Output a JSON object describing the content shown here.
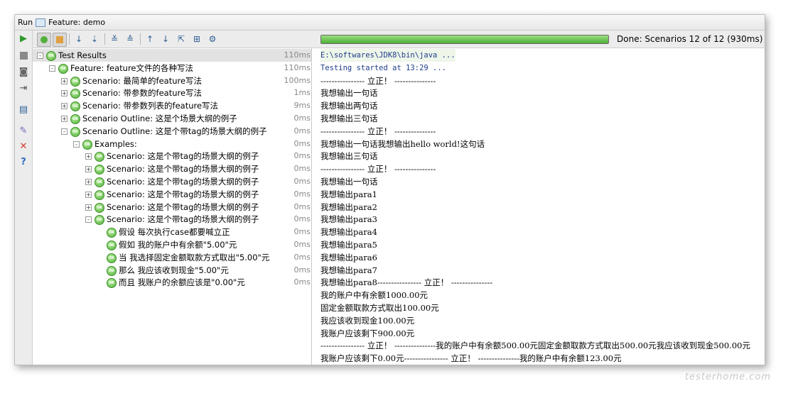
{
  "window": {
    "title_prefix": "Run",
    "tab_label": "Feature: demo"
  },
  "status": {
    "text": "Done: Scenarios 12 of 12  (930ms)",
    "progress_fraction": 1.0
  },
  "tree": {
    "rows": [
      {
        "label": "Test Results",
        "time": "110ms"
      },
      {
        "label": "Feature: feature文件的各种写法",
        "time": "110ms"
      },
      {
        "label": "Scenario: 最简单的feature写法",
        "time": "100ms"
      },
      {
        "label": "Scenario: 带参数的feature写法",
        "time": "1ms"
      },
      {
        "label": "Scenario: 带参数列表的feature写法",
        "time": "9ms"
      },
      {
        "label": "Scenario Outline: 这是个场景大纲的例子",
        "time": "0ms"
      },
      {
        "label": "Scenario Outline: 这是个带tag的场景大纲的例子",
        "time": "0ms"
      },
      {
        "label": "Examples:",
        "time": "0ms"
      },
      {
        "label": "Scenario: 这是个带tag的场景大纲的例子",
        "time": "0ms"
      },
      {
        "label": "Scenario: 这是个带tag的场景大纲的例子",
        "time": "0ms"
      },
      {
        "label": "Scenario: 这是个带tag的场景大纲的例子",
        "time": "0ms"
      },
      {
        "label": "Scenario: 这是个带tag的场景大纲的例子",
        "time": "0ms"
      },
      {
        "label": "Scenario: 这是个带tag的场景大纲的例子",
        "time": "0ms"
      },
      {
        "label": "Scenario: 这是个带tag的场景大纲的例子",
        "time": "0ms"
      },
      {
        "label": "假设 每次执行case都要喊立正",
        "time": "0ms"
      },
      {
        "label": "假如 我的账户中有余额\"5.00\"元",
        "time": "0ms"
      },
      {
        "label": "当 我选择固定金额取款方式取出\"5.00\"元",
        "time": "0ms"
      },
      {
        "label": "那么 我应该收到现金\"5.00\"元",
        "time": "0ms"
      },
      {
        "label": "而且 我账户的余额应该是\"0.00\"元",
        "time": "0ms"
      }
    ]
  },
  "console": {
    "lines": [
      "E:\\softwares\\JDK8\\bin\\java ...",
      "Testing started at 13:29 ...",
      "----------------  立正！  ---------------",
      "我想输出一句话",
      "我想输出两句话",
      "我想输出三句话",
      "----------------  立正！  ---------------",
      "我想输出一句话我想输出hello world!这句话",
      "我想输出三句话",
      "----------------  立正！  ---------------",
      "我想输出一句话",
      "我想输出para1",
      "我想输出para2",
      "我想输出para3",
      "我想输出para4",
      "我想输出para5",
      "我想输出para6",
      "我想输出para7",
      "我想输出para8----------------  立正！  ---------------",
      "我的账户中有余额1000.00元",
      "固定金额取款方式取出100.00元",
      "我应该收到现金100.00元",
      "我账户应该剩下900.00元",
      "----------------  立正！  ---------------我的账户中有余额500.00元固定金额取款方式取出500.00元我应该收到现金500.00元",
      "我账户应该剩下0.00元----------------  立正！  ---------------我的账户中有余额123.00元"
    ]
  },
  "watermark": "testerhome.com",
  "colors": {
    "ok_green": "#52b03a",
    "progress_green": "#4fae37",
    "run_green": "#2e9b2e",
    "stop_red": "#d33b2c"
  }
}
